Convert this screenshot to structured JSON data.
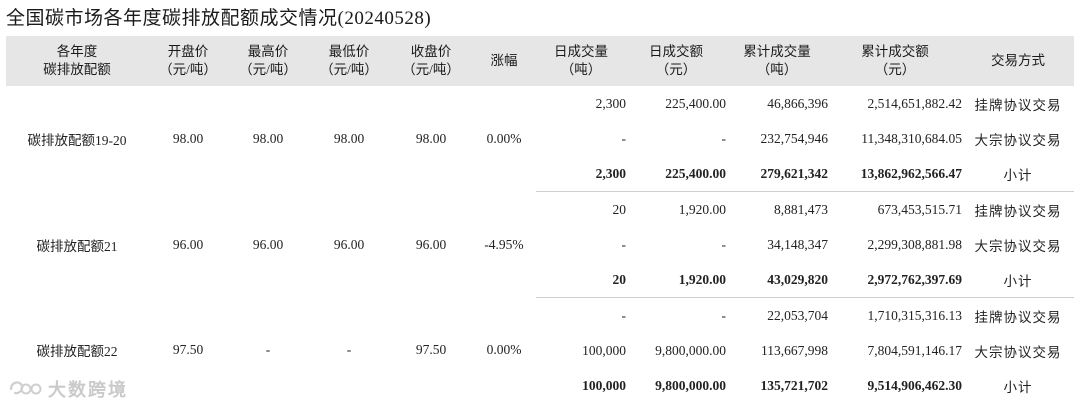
{
  "title": "全国碳市场各年度碳排放配额成交情况(20240528)",
  "headers": {
    "item": [
      "各年度",
      "碳排放配额"
    ],
    "open": [
      "开盘价",
      "（元/吨）"
    ],
    "high": [
      "最高价",
      "（元/吨）"
    ],
    "low": [
      "最低价",
      "（元/吨）"
    ],
    "close": [
      "收盘价",
      "（元/吨）"
    ],
    "change": [
      "涨幅"
    ],
    "daily_vol": [
      "日成交量",
      "（吨）"
    ],
    "daily_amt": [
      "日成交额",
      "（元）"
    ],
    "cum_vol": [
      "累计成交量",
      "（吨）"
    ],
    "cum_amt": [
      "累计成交额",
      "（元）"
    ],
    "method": [
      "交易方式"
    ]
  },
  "groups": [
    {
      "name": "碳排放配额19-20",
      "open": "98.00",
      "high": "98.00",
      "low": "98.00",
      "close": "98.00",
      "change": "0.00%",
      "rows": [
        {
          "daily_vol": "2,300",
          "daily_amt": "225,400.00",
          "cum_vol": "46,866,396",
          "cum_amt": "2,514,651,882.42",
          "method": "挂牌协议交易"
        },
        {
          "daily_vol": "-",
          "daily_amt": "-",
          "cum_vol": "232,754,946",
          "cum_amt": "11,348,310,684.05",
          "method": "大宗协议交易"
        },
        {
          "daily_vol": "2,300",
          "daily_amt": "225,400.00",
          "cum_vol": "279,621,342",
          "cum_amt": "13,862,962,566.47",
          "method": "小计"
        }
      ]
    },
    {
      "name": "碳排放配额21",
      "open": "96.00",
      "high": "96.00",
      "low": "96.00",
      "close": "96.00",
      "change": "-4.95%",
      "rows": [
        {
          "daily_vol": "20",
          "daily_amt": "1,920.00",
          "cum_vol": "8,881,473",
          "cum_amt": "673,453,515.71",
          "method": "挂牌协议交易"
        },
        {
          "daily_vol": "-",
          "daily_amt": "-",
          "cum_vol": "34,148,347",
          "cum_amt": "2,299,308,881.98",
          "method": "大宗协议交易"
        },
        {
          "daily_vol": "20",
          "daily_amt": "1,920.00",
          "cum_vol": "43,029,820",
          "cum_amt": "2,972,762,397.69",
          "method": "小计"
        }
      ]
    },
    {
      "name": "碳排放配额22",
      "open": "97.50",
      "high": "-",
      "low": "-",
      "close": "97.50",
      "change": "0.00%",
      "rows": [
        {
          "daily_vol": "-",
          "daily_amt": "-",
          "cum_vol": "22,053,704",
          "cum_amt": "1,710,315,316.13",
          "method": "挂牌协议交易"
        },
        {
          "daily_vol": "100,000",
          "daily_amt": "9,800,000.00",
          "cum_vol": "113,667,998",
          "cum_amt": "7,804,591,146.17",
          "method": "大宗协议交易"
        },
        {
          "daily_vol": "100,000",
          "daily_amt": "9,800,000.00",
          "cum_vol": "135,721,702",
          "cum_amt": "9,514,906,462.30",
          "method": "小计"
        }
      ]
    }
  ],
  "watermark": {
    "text": "大数跨境",
    "icon": "dashuju-logo-icon"
  }
}
